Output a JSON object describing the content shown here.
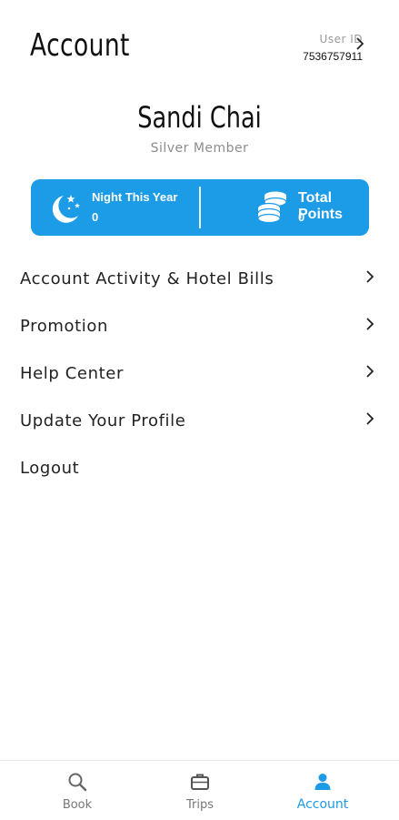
{
  "header": {
    "title": "Account",
    "user_id_label": "User ID",
    "user_id_value": "7536757911"
  },
  "profile": {
    "name": "Sandi Chai",
    "tier": "Silver Member"
  },
  "stats": [
    {
      "label": "Night This Year",
      "value": "0",
      "icon": "moon-stars-icon"
    },
    {
      "label": "Total Points",
      "value": "0",
      "icon": "coins-stack-icon"
    }
  ],
  "menu": [
    {
      "label": "Account Activity & Hotel Bills",
      "has_chevron": true
    },
    {
      "label": "Promotion",
      "has_chevron": true
    },
    {
      "label": "Help Center",
      "has_chevron": true
    },
    {
      "label": "Update Your Profile",
      "has_chevron": true
    },
    {
      "label": "Logout",
      "has_chevron": false
    }
  ],
  "tabbar": [
    {
      "label": "Book",
      "icon": "search-icon",
      "active": false
    },
    {
      "label": "Trips",
      "icon": "briefcase-icon",
      "active": false
    },
    {
      "label": "Account",
      "icon": "person-icon",
      "active": true
    }
  ],
  "colors": {
    "accent": "#1c9be6",
    "text": "#222222",
    "muted": "#8c8c8c"
  }
}
